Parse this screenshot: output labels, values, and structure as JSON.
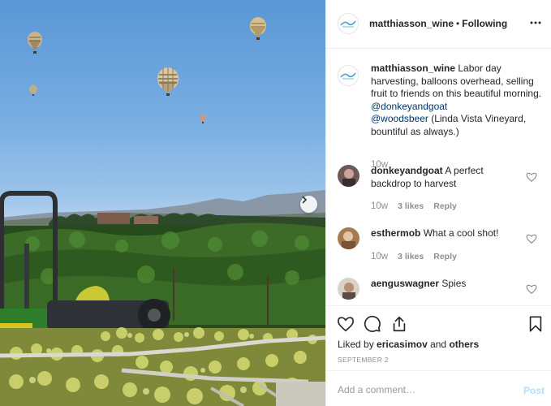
{
  "post": {
    "username": "matthiasson_wine",
    "separator": "•",
    "follow_status": "Following",
    "more_icon": "more-horizontal-icon",
    "carousel_icon": "chevron-right-icon"
  },
  "caption": {
    "username": "matthiasson_wine",
    "text_1": " Labor day harvesting, balloons overhead, selling fruit to friends on this beautiful morning. ",
    "mention_1": "@donkeyandgoat",
    "mention_2": "@woodsbeer",
    "text_2": " (Linda Vista Vineyard, bountiful as always.)",
    "time": "10w"
  },
  "comments": [
    {
      "username": "donkeyandgoat",
      "text": " A perfect backdrop to harvest",
      "time": "10w",
      "likes": "3 likes",
      "reply": "Reply"
    },
    {
      "username": "esthermob",
      "text": " What a cool shot!",
      "time": "10w",
      "likes": "3 likes",
      "reply": "Reply"
    },
    {
      "username": "aenguswagner",
      "text": " Spies"
    }
  ],
  "actions": {
    "liked_prefix": "Liked by ",
    "liked_user": "ericasimov",
    "liked_and": " and ",
    "liked_others": "others",
    "date": "SEPTEMBER 2",
    "icons": [
      "heart-icon",
      "comment-icon",
      "share-icon",
      "bookmark-icon"
    ]
  },
  "add_comment": {
    "placeholder": "Add a comment…",
    "post_label": "Post"
  },
  "colors": {
    "link": "#003569",
    "post_disabled": "#b2dffc",
    "muted": "#8e8e8e"
  }
}
